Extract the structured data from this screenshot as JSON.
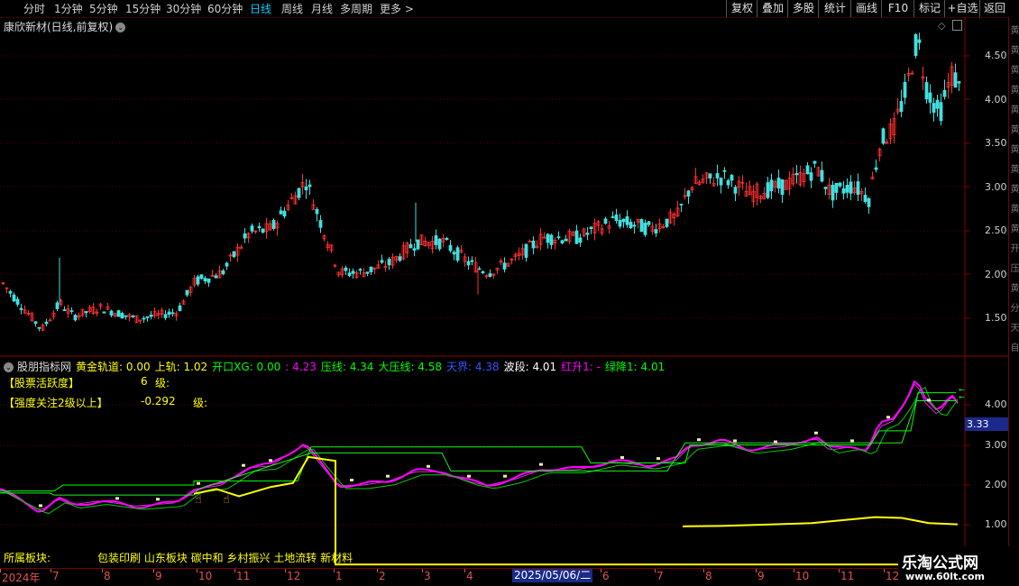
{
  "toolbar": {
    "periods": [
      {
        "label": "分时",
        "active": false
      },
      {
        "label": "1分钟",
        "active": false
      },
      {
        "label": "5分钟",
        "active": false
      },
      {
        "label": "15分钟",
        "active": false
      },
      {
        "label": "30分钟",
        "active": false
      },
      {
        "label": "60分钟",
        "active": false
      },
      {
        "label": "日线",
        "active": true
      },
      {
        "label": "周线",
        "active": false
      },
      {
        "label": "月线",
        "active": false
      },
      {
        "label": "多周期",
        "active": false
      },
      {
        "label": "更多 >",
        "active": false
      }
    ],
    "right_buttons": [
      "复权",
      "叠加",
      "多股",
      "统计",
      "画线",
      "F10",
      "标记",
      "+自选",
      "返回"
    ]
  },
  "main_chart": {
    "title": "康欣新材(日线,前复权)",
    "price_axis": [
      "4.50",
      "4.00",
      "3.50",
      "3.00",
      "2.50",
      "2.00",
      "1.50"
    ]
  },
  "indicator": {
    "name": "股朋指标网",
    "values": [
      {
        "text": "黄金轨道: 0.00",
        "color": "#ffff00"
      },
      {
        "text": "上轨: 1.02",
        "color": "#ffff00"
      },
      {
        "text": "开口XG: 0.00",
        "color": "#00ff00"
      },
      {
        "text": ": 4.23",
        "color": "#ff00ff"
      },
      {
        "text": "压线: 4.34",
        "color": "#00ff00"
      },
      {
        "text": "大压线: 4.58",
        "color": "#00ff00"
      },
      {
        "text": "天界: 4.38",
        "color": "#3355ff"
      },
      {
        "text": "波段: 4.01",
        "color": "#ffffff"
      },
      {
        "text": "红升1: -",
        "color": "#ff00ff"
      },
      {
        "text": "绿降1: 4.01",
        "color": "#00ff00"
      }
    ],
    "activity_label": "【股票活跃度】",
    "activity_value": "6",
    "activity_unit": "级:",
    "strength_label": "【强度关注2级以上】",
    "strength_value": "-0.292",
    "strength_unit": "级:",
    "axis": [
      "4.00",
      "3.00",
      "2.00",
      "1.00"
    ],
    "current_price": "3.33"
  },
  "sector": {
    "label": "所属板块:",
    "values": "包装印刷 山东板块 碳中和 乡村振兴 土地流转 新材料"
  },
  "dates": {
    "labels": [
      "2024年",
      "7",
      "8",
      "9",
      "10",
      "11",
      "12",
      "1",
      "2",
      "3",
      "4",
      "5",
      "6",
      "7",
      "8",
      "9",
      "10",
      "11",
      "12"
    ],
    "highlight": "2025/05/06/二"
  },
  "side_chars": [
    "黄",
    "黄",
    "黄",
    "黄",
    "黄",
    "黄",
    "黄",
    "黄",
    "黄",
    "黄",
    "黄",
    "开",
    "压",
    "黄",
    "分",
    "天",
    "自"
  ],
  "watermark": {
    "title": "乐淘公式网",
    "url": "www.60lt.com"
  },
  "colors": {
    "up": "#ff3030",
    "down": "#40e0e0",
    "magenta": "#ff00ff",
    "green": "#00ff00",
    "yellow": "#ffff00"
  }
}
